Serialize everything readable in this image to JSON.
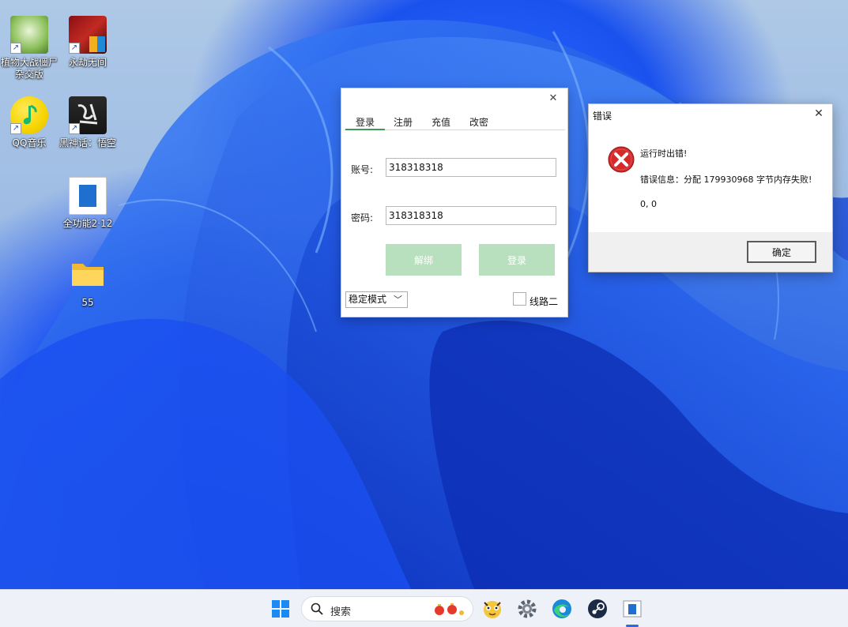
{
  "desktop": {
    "icons": [
      {
        "label": "植物大战僵尸杂交版",
        "icon": "plants-vs-zombies-icon"
      },
      {
        "label": "永劫无间",
        "icon": "naraka-icon"
      },
      {
        "label": "QQ音乐",
        "icon": "qq-music-icon"
      },
      {
        "label": "黑神话：悟空",
        "icon": "black-myth-wukong-icon"
      },
      {
        "label": "全功能2·12",
        "icon": "app-window-icon"
      },
      {
        "label": "55",
        "icon": "folder-icon"
      }
    ]
  },
  "login_window": {
    "tabs": [
      {
        "label": "登录",
        "active": true
      },
      {
        "label": "注册",
        "active": false
      },
      {
        "label": "充值",
        "active": false
      },
      {
        "label": "改密",
        "active": false
      }
    ],
    "account_label": "账号:",
    "account_value": "318318318",
    "password_label": "密码:",
    "password_value": "318318318",
    "unbind_label": "解绑",
    "login_label": "登录",
    "mode_value": "稳定模式",
    "line_label": "线路二",
    "close_glyph": "✕"
  },
  "error_dialog": {
    "title": "错误",
    "close_glyph": "✕",
    "line1": "运行时出错!",
    "line2": "错误信息：分配 179930968 字节内存失败!",
    "line3": "0, 0",
    "ok_label": "确定"
  },
  "taskbar": {
    "search_label": "搜索",
    "items": [
      "windows-start-icon",
      "search-icon",
      "game-mascot-icon",
      "settings-gear-icon",
      "edge-browser-icon",
      "steam-icon",
      "app-window-icon"
    ]
  },
  "colors": {
    "accent_green": "#3f9a55",
    "button_green": "#b9e0be",
    "error_red": "#d42a2a",
    "taskbar_bg": "#eef1f7"
  }
}
